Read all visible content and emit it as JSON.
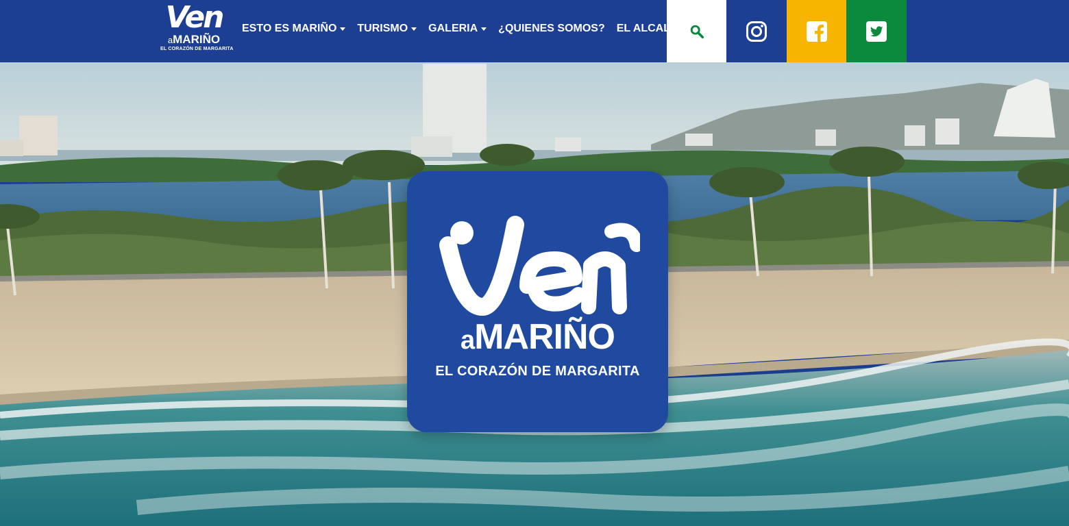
{
  "brand": {
    "ven": "Ven",
    "a": "a",
    "marino": "MARIÑO",
    "tagline": "EL CORAZÓN DE MARGARITA"
  },
  "nav": {
    "items": [
      {
        "label": "ESTO ES MARIÑO",
        "dropdown": true
      },
      {
        "label": "TURISMO",
        "dropdown": true
      },
      {
        "label": "GALERIA",
        "dropdown": true
      },
      {
        "label": "¿QUIENES SOMOS?",
        "dropdown": false
      },
      {
        "label": "EL ALCALDE",
        "dropdown": false
      }
    ]
  },
  "social": {
    "search_icon": "search-icon",
    "instagram_icon": "instagram-icon",
    "facebook_icon": "facebook-icon",
    "twitter_icon": "twitter-icon"
  },
  "hero": {
    "logo": {
      "a": "a",
      "marino": "MARIÑO",
      "tagline": "EL CORAZÓN DE MARGARITA"
    }
  },
  "colors": {
    "navbar": "#1c3f94",
    "search_bg": "#ffffff",
    "search_icon": "#0b8a3e",
    "facebook_bg": "#f7b500",
    "twitter_bg": "#0b8a3e",
    "logo_card": "#1f4aa0"
  }
}
